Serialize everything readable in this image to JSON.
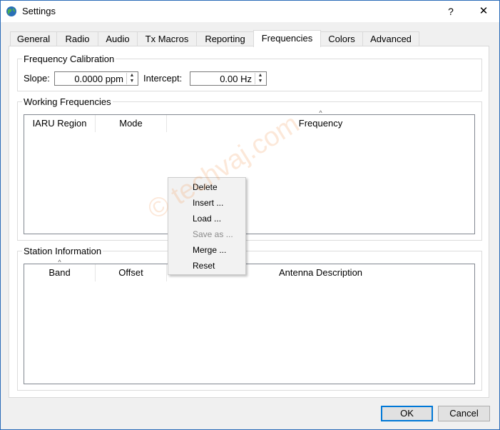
{
  "window": {
    "title": "Settings",
    "help_glyph": "?",
    "close_glyph": "✕"
  },
  "tabs": [
    "General",
    "Radio",
    "Audio",
    "Tx Macros",
    "Reporting",
    "Frequencies",
    "Colors",
    "Advanced"
  ],
  "active_tab": "Frequencies",
  "frequency_calibration": {
    "title": "Frequency Calibration",
    "slope_label": "Slope:",
    "slope_value": "0.0000 ppm",
    "intercept_label": "Intercept:",
    "intercept_value": "0.00 Hz"
  },
  "working_frequencies": {
    "title": "Working Frequencies",
    "columns": [
      "IARU Region",
      "Mode",
      "Frequency"
    ],
    "sorted_column": "Frequency",
    "rows": []
  },
  "station_information": {
    "title": "Station Information",
    "columns": [
      "Band",
      "Offset",
      "Antenna Description"
    ],
    "sorted_column": "Band",
    "rows": []
  },
  "context_menu": {
    "items": [
      {
        "label": "Delete",
        "enabled": true
      },
      {
        "label": "Insert ...",
        "enabled": true
      },
      {
        "label": "Load ...",
        "enabled": true
      },
      {
        "label": "Save as ...",
        "enabled": false
      },
      {
        "label": "Merge ...",
        "enabled": true
      },
      {
        "label": "Reset",
        "enabled": true
      }
    ]
  },
  "buttons": {
    "ok": "OK",
    "cancel": "Cancel"
  },
  "watermark": "techvaj.com",
  "colors": {
    "accent": "#0078d7",
    "title_bar": "#ffffff",
    "watermark": "#f09650"
  }
}
